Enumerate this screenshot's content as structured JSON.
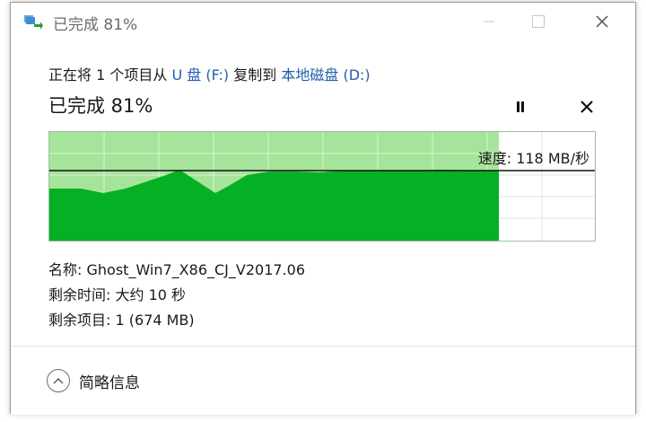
{
  "window": {
    "title": "已完成 81%"
  },
  "description": {
    "prefix": "正在将 1 个项目从 ",
    "source": "U 盘 (F:)",
    "middle": " 复制到 ",
    "dest": "本地磁盘 (D:)"
  },
  "progress": {
    "title": "已完成 81%",
    "percent": 81
  },
  "chart": {
    "speed_label": "速度:",
    "speed_value": "118 MB/秒",
    "colors": {
      "fill": "#06b025",
      "light": "#a7e49b",
      "grid": "#ffffff"
    }
  },
  "details": {
    "name_label": "名称:",
    "name_value": "Ghost_Win7_X86_CJ_V2017.06",
    "time_label": "剩余时间:",
    "time_value": "大约 10 秒",
    "items_label": "剩余项目:",
    "items_value": "1 (674 MB)"
  },
  "footer": {
    "collapse_label": "简略信息"
  },
  "icons": {
    "app": "copy-icon",
    "minimize": "minimize-icon",
    "maximize": "maximize-icon",
    "close": "close-icon",
    "pause": "pause-icon",
    "cancel": "cancel-icon",
    "collapse": "chevron-up-icon"
  }
}
